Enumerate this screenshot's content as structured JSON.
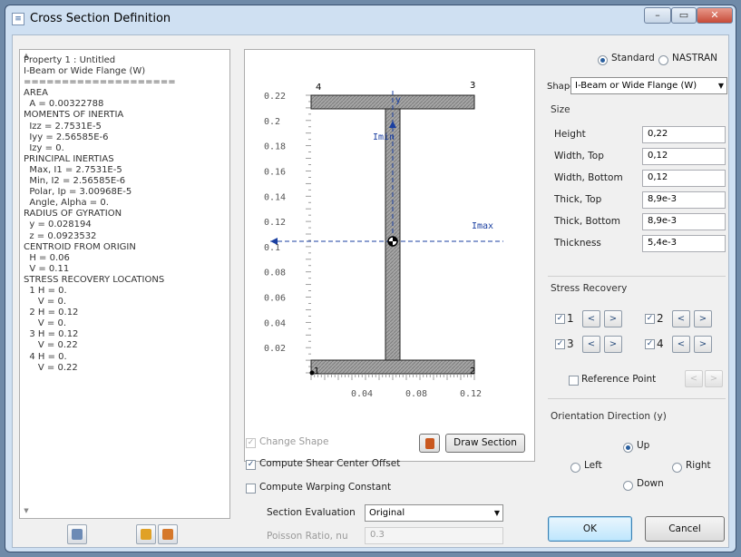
{
  "window": {
    "title": "Cross Section Definition",
    "minimize": "–",
    "maximize": "▭",
    "close": "✕"
  },
  "properties_text": [
    "Property 1 : Untitled",
    "I-Beam or Wide Flange (W)",
    "====================",
    "AREA",
    "  A = 0.00322788",
    "MOMENTS OF INERTIA",
    "  Izz = 2.7531E-5",
    "  Iyy = 2.56585E-6",
    "  Izy = 0.",
    "PRINCIPAL INERTIAS",
    "  Max, I1 = 2.7531E-5",
    "  Min, I2 = 2.56585E-6",
    "  Polar, Ip = 3.00968E-5",
    "  Angle, Alpha = 0.",
    "RADIUS OF GYRATION",
    "  y = 0.028194",
    "  z = 0.0923532",
    "CENTROID FROM ORIGIN",
    "  H = 0.06",
    "  V = 0.11",
    "STRESS RECOVERY LOCATIONS",
    "  1 H = 0.",
    "     V = 0.",
    "  2 H = 0.12",
    "     V = 0.",
    "  3 H = 0.12",
    "     V = 0.22",
    "  4 H = 0.",
    "     V = 0.22"
  ],
  "drawing": {
    "y_ticks": [
      "0.22",
      "0.2",
      "0.18",
      "0.16",
      "0.14",
      "0.12",
      "0.1",
      "0.08",
      "0.06",
      "0.04",
      "0.02"
    ],
    "x_ticks": [
      "0.04",
      "0.08",
      "0.12"
    ],
    "corner_labels": [
      "1",
      "2",
      "3",
      "4"
    ],
    "y_axis_label": "y",
    "imin_label": "Imin",
    "imax_label": "Imax"
  },
  "options": {
    "change_shape": "Change Shape",
    "draw_section": "Draw Section",
    "compute_shear_center_offset": "Compute Shear Center Offset",
    "compute_shear_center_offset_checked": true,
    "compute_warping_constant": "Compute Warping Constant",
    "compute_warping_constant_checked": false,
    "section_evaluation_label": "Section Evaluation",
    "section_evaluation_value": "Original",
    "poisson_label": "Poisson Ratio, nu",
    "poisson_value": "0.3"
  },
  "type": {
    "standard": "Standard",
    "nastran": "NASTRAN",
    "selected": "Standard"
  },
  "shape": {
    "label": "Shape",
    "value": "I-Beam or Wide Flange (W)"
  },
  "size": {
    "title": "Size",
    "fields": [
      {
        "label": "Height",
        "value": "0,22"
      },
      {
        "label": "Width, Top",
        "value": "0,12"
      },
      {
        "label": "Width, Bottom",
        "value": "0,12"
      },
      {
        "label": "Thick, Top",
        "value": "8,9e-3"
      },
      {
        "label": "Thick, Bottom",
        "value": "8,9e-3"
      },
      {
        "label": "Thickness",
        "value": "5,4e-3"
      }
    ]
  },
  "stress_recovery": {
    "title": "Stress Recovery",
    "points": [
      "1",
      "2",
      "3",
      "4"
    ],
    "prev": "<",
    "next": ">",
    "reference_point": "Reference Point"
  },
  "orientation": {
    "title": "Orientation Direction (y)",
    "up": "Up",
    "left": "Left",
    "right": "Right",
    "down": "Down",
    "selected": "Up"
  },
  "buttons": {
    "ok": "OK",
    "cancel": "Cancel"
  },
  "colors": {
    "flange_fill": "#9b9b9b",
    "hatch": "#555555",
    "axis_dashed": "#1a3fa0",
    "ok_border": "#3c7fb1"
  }
}
